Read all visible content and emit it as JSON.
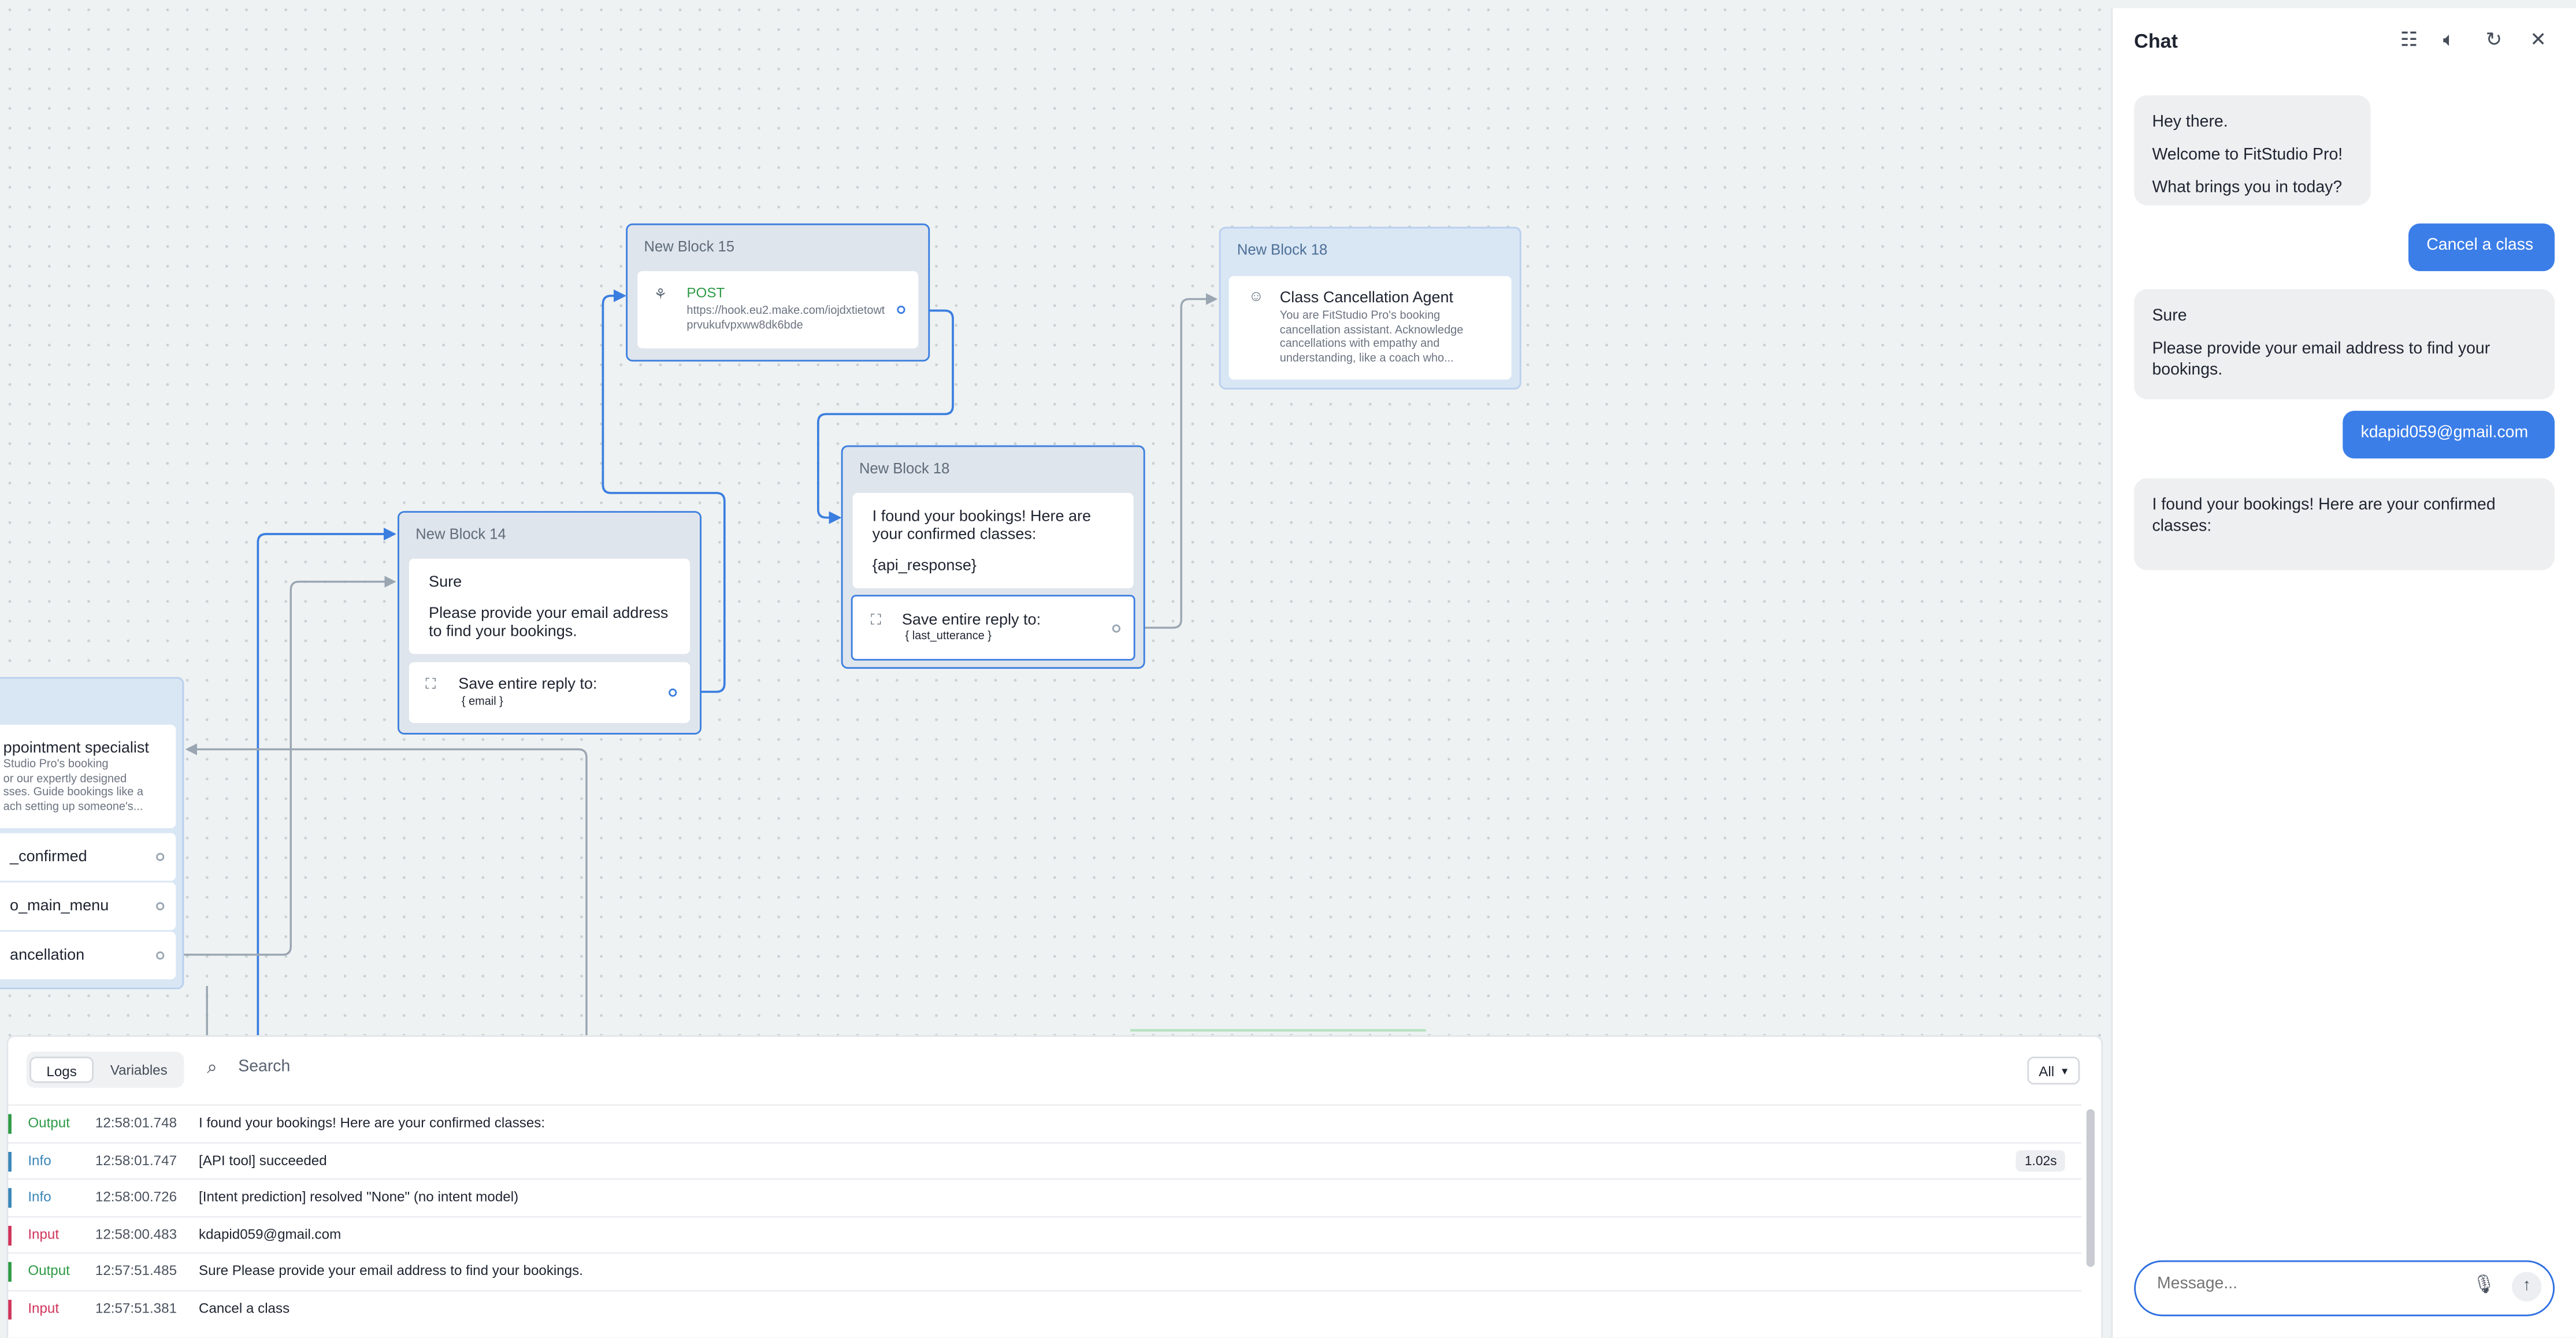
{
  "canvas": {
    "blocks": [
      {
        "title": "New Block 15",
        "method": "POST",
        "url": "https://hook.eu2.make.com/iojdxtietowtprvukufvpxww8dk6bde"
      },
      {
        "title": "New Block 18",
        "agent_name": "Class Cancellation Agent",
        "agent_desc": "You are FitStudio Pro's booking cancellation assistant. Acknowledge cancellations with empathy and understanding, like a coach who..."
      },
      {
        "title": "New Block 14",
        "text1": "Sure",
        "text2": "Please provide your email address to find your bookings.",
        "save_label": "Save entire reply to:",
        "save_var": "{ email }"
      },
      {
        "title": "New Block 18",
        "text1": "I found your bookings! Here are your confirmed classes:",
        "text2": "{api_response}",
        "save_label": "Save entire reply to:",
        "save_var": "{ last_utterance }"
      },
      {
        "agent_name": "ppointment specialist",
        "agent_desc": "Studio Pro's booking\nor our expertly designed\nsses. Guide bookings like a\nach setting up someone's...",
        "paths": [
          "_confirmed",
          "o_main_menu",
          "ancellation"
        ]
      }
    ]
  },
  "chat": {
    "title": "Chat",
    "icons": [
      "settings-sliders-icon",
      "mute-icon",
      "restart-icon",
      "close-icon"
    ],
    "messages": [
      {
        "role": "bot",
        "lines": [
          "Hey there.",
          "Welcome to FitStudio Pro!",
          "What brings you in today?"
        ]
      },
      {
        "role": "user",
        "text": "Cancel a class"
      },
      {
        "role": "bot",
        "lines": [
          "Sure",
          "Please provide your email address to find your bookings."
        ]
      },
      {
        "role": "user",
        "text": "kdapid059@gmail.com"
      },
      {
        "role": "bot",
        "lines": [
          "I found your bookings! Here are your confirmed classes:"
        ]
      }
    ],
    "input_placeholder": "Message..."
  },
  "logs": {
    "tabs": [
      "Logs",
      "Variables"
    ],
    "search_placeholder": "Search",
    "filter": "All",
    "rows": [
      {
        "type": "Output",
        "time": "12:58:01.748",
        "message": "I found your bookings! Here are your confirmed classes:",
        "duration": ""
      },
      {
        "type": "Info",
        "time": "12:58:01.747",
        "message": "[API tool] succeeded",
        "duration": "1.02s"
      },
      {
        "type": "Info",
        "time": "12:58:00.726",
        "message": "[Intent prediction] resolved \"None\" (no intent model)",
        "duration": ""
      },
      {
        "type": "Input",
        "time": "12:58:00.483",
        "message": "kdapid059@gmail.com",
        "duration": ""
      },
      {
        "type": "Output",
        "time": "12:57:51.485",
        "message": "Sure Please provide your email address to find your bookings.",
        "duration": ""
      },
      {
        "type": "Input",
        "time": "12:57:51.381",
        "message": "Cancel a class",
        "duration": ""
      }
    ],
    "type_colors": {
      "Output": "#2e9a46",
      "Info": "#3a86b8",
      "Input": "#d0345a"
    }
  }
}
